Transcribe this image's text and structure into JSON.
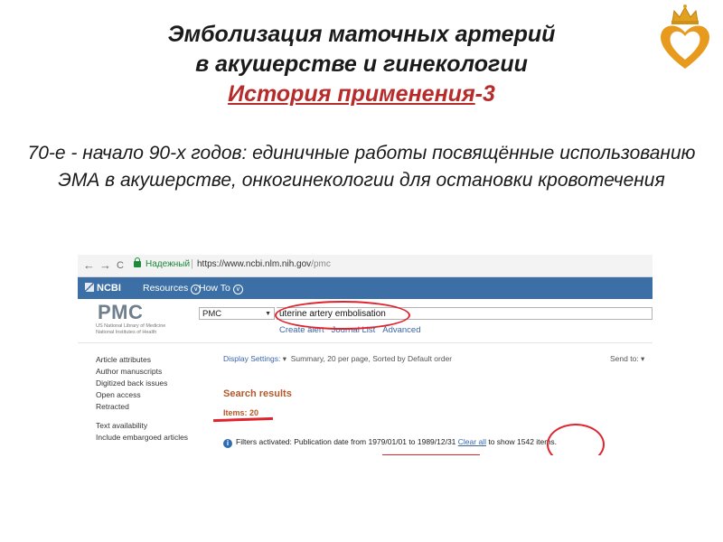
{
  "slide": {
    "title_line1": "Эмболизация маточных артерий",
    "title_line2": "в акушерстве и гинекологии",
    "title_line3_underlined": "История применения",
    "title_line3_suffix": "-3",
    "body_text": "70-е - начало 90-х годов: единичные работы посвящённые использованию ЭМА в акушерстве, онкогинекологии для остановки кровотечения",
    "logo_icon": "crown-heart-logo"
  },
  "browser": {
    "back_icon": "←",
    "forward_icon": "→",
    "reload_icon": "C",
    "secure_label": "Надежный",
    "url_host": "https://www.ncbi.nlm.nih.gov",
    "url_path": "/pmc"
  },
  "ncbi_bar": {
    "logo": "NCBI",
    "resources": "Resources",
    "howto": "How To"
  },
  "pmc": {
    "logo": "PMC",
    "sub_line1": "US National Library of Medicine",
    "sub_line2": "National Institutes of Health",
    "db_value": "PMC",
    "search_value": "uterine artery embolisation",
    "link_create_alert": "Create alert",
    "link_journal_list": "Journal List",
    "link_advanced": "Advanced"
  },
  "sidebar": {
    "group1": [
      "Article attributes",
      "Author manuscripts",
      "Digitized back issues",
      "Open access",
      "Retracted"
    ],
    "group2": [
      "Text availability",
      "Include embargoed articles"
    ]
  },
  "results": {
    "display_settings_label": "Display Settings:",
    "display_settings_value": "Summary, 20 per page, Sorted by Default order",
    "send_to": "Send to:",
    "search_results_title": "Search results",
    "items_label": "Items: 20",
    "filters_prefix": "Filters activated: Publication date from",
    "date_from": "1979/01/01",
    "date_to_word": "to",
    "date_to": "1989/12/31",
    "clear_all": "Clear all",
    "to_show": "to show",
    "count": "1542 items."
  },
  "colors": {
    "title_accent": "#b72b2b",
    "ncbi_blue": "#3b6fa5",
    "result_orange": "#b5582a",
    "annotation_red": "#e0242e"
  }
}
